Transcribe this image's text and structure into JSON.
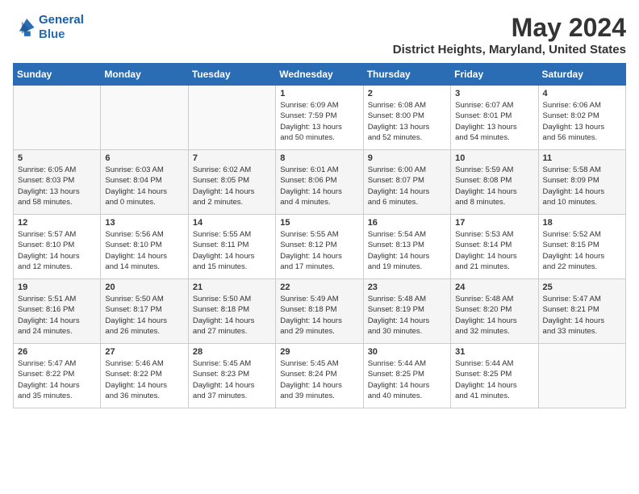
{
  "header": {
    "logo_line1": "General",
    "logo_line2": "Blue",
    "month": "May 2024",
    "location": "District Heights, Maryland, United States"
  },
  "weekdays": [
    "Sunday",
    "Monday",
    "Tuesday",
    "Wednesday",
    "Thursday",
    "Friday",
    "Saturday"
  ],
  "weeks": [
    [
      {
        "day": "",
        "text": ""
      },
      {
        "day": "",
        "text": ""
      },
      {
        "day": "",
        "text": ""
      },
      {
        "day": "1",
        "text": "Sunrise: 6:09 AM\nSunset: 7:59 PM\nDaylight: 13 hours\nand 50 minutes."
      },
      {
        "day": "2",
        "text": "Sunrise: 6:08 AM\nSunset: 8:00 PM\nDaylight: 13 hours\nand 52 minutes."
      },
      {
        "day": "3",
        "text": "Sunrise: 6:07 AM\nSunset: 8:01 PM\nDaylight: 13 hours\nand 54 minutes."
      },
      {
        "day": "4",
        "text": "Sunrise: 6:06 AM\nSunset: 8:02 PM\nDaylight: 13 hours\nand 56 minutes."
      }
    ],
    [
      {
        "day": "5",
        "text": "Sunrise: 6:05 AM\nSunset: 8:03 PM\nDaylight: 13 hours\nand 58 minutes."
      },
      {
        "day": "6",
        "text": "Sunrise: 6:03 AM\nSunset: 8:04 PM\nDaylight: 14 hours\nand 0 minutes."
      },
      {
        "day": "7",
        "text": "Sunrise: 6:02 AM\nSunset: 8:05 PM\nDaylight: 14 hours\nand 2 minutes."
      },
      {
        "day": "8",
        "text": "Sunrise: 6:01 AM\nSunset: 8:06 PM\nDaylight: 14 hours\nand 4 minutes."
      },
      {
        "day": "9",
        "text": "Sunrise: 6:00 AM\nSunset: 8:07 PM\nDaylight: 14 hours\nand 6 minutes."
      },
      {
        "day": "10",
        "text": "Sunrise: 5:59 AM\nSunset: 8:08 PM\nDaylight: 14 hours\nand 8 minutes."
      },
      {
        "day": "11",
        "text": "Sunrise: 5:58 AM\nSunset: 8:09 PM\nDaylight: 14 hours\nand 10 minutes."
      }
    ],
    [
      {
        "day": "12",
        "text": "Sunrise: 5:57 AM\nSunset: 8:10 PM\nDaylight: 14 hours\nand 12 minutes."
      },
      {
        "day": "13",
        "text": "Sunrise: 5:56 AM\nSunset: 8:10 PM\nDaylight: 14 hours\nand 14 minutes."
      },
      {
        "day": "14",
        "text": "Sunrise: 5:55 AM\nSunset: 8:11 PM\nDaylight: 14 hours\nand 15 minutes."
      },
      {
        "day": "15",
        "text": "Sunrise: 5:55 AM\nSunset: 8:12 PM\nDaylight: 14 hours\nand 17 minutes."
      },
      {
        "day": "16",
        "text": "Sunrise: 5:54 AM\nSunset: 8:13 PM\nDaylight: 14 hours\nand 19 minutes."
      },
      {
        "day": "17",
        "text": "Sunrise: 5:53 AM\nSunset: 8:14 PM\nDaylight: 14 hours\nand 21 minutes."
      },
      {
        "day": "18",
        "text": "Sunrise: 5:52 AM\nSunset: 8:15 PM\nDaylight: 14 hours\nand 22 minutes."
      }
    ],
    [
      {
        "day": "19",
        "text": "Sunrise: 5:51 AM\nSunset: 8:16 PM\nDaylight: 14 hours\nand 24 minutes."
      },
      {
        "day": "20",
        "text": "Sunrise: 5:50 AM\nSunset: 8:17 PM\nDaylight: 14 hours\nand 26 minutes."
      },
      {
        "day": "21",
        "text": "Sunrise: 5:50 AM\nSunset: 8:18 PM\nDaylight: 14 hours\nand 27 minutes."
      },
      {
        "day": "22",
        "text": "Sunrise: 5:49 AM\nSunset: 8:18 PM\nDaylight: 14 hours\nand 29 minutes."
      },
      {
        "day": "23",
        "text": "Sunrise: 5:48 AM\nSunset: 8:19 PM\nDaylight: 14 hours\nand 30 minutes."
      },
      {
        "day": "24",
        "text": "Sunrise: 5:48 AM\nSunset: 8:20 PM\nDaylight: 14 hours\nand 32 minutes."
      },
      {
        "day": "25",
        "text": "Sunrise: 5:47 AM\nSunset: 8:21 PM\nDaylight: 14 hours\nand 33 minutes."
      }
    ],
    [
      {
        "day": "26",
        "text": "Sunrise: 5:47 AM\nSunset: 8:22 PM\nDaylight: 14 hours\nand 35 minutes."
      },
      {
        "day": "27",
        "text": "Sunrise: 5:46 AM\nSunset: 8:22 PM\nDaylight: 14 hours\nand 36 minutes."
      },
      {
        "day": "28",
        "text": "Sunrise: 5:45 AM\nSunset: 8:23 PM\nDaylight: 14 hours\nand 37 minutes."
      },
      {
        "day": "29",
        "text": "Sunrise: 5:45 AM\nSunset: 8:24 PM\nDaylight: 14 hours\nand 39 minutes."
      },
      {
        "day": "30",
        "text": "Sunrise: 5:44 AM\nSunset: 8:25 PM\nDaylight: 14 hours\nand 40 minutes."
      },
      {
        "day": "31",
        "text": "Sunrise: 5:44 AM\nSunset: 8:25 PM\nDaylight: 14 hours\nand 41 minutes."
      },
      {
        "day": "",
        "text": ""
      }
    ]
  ]
}
